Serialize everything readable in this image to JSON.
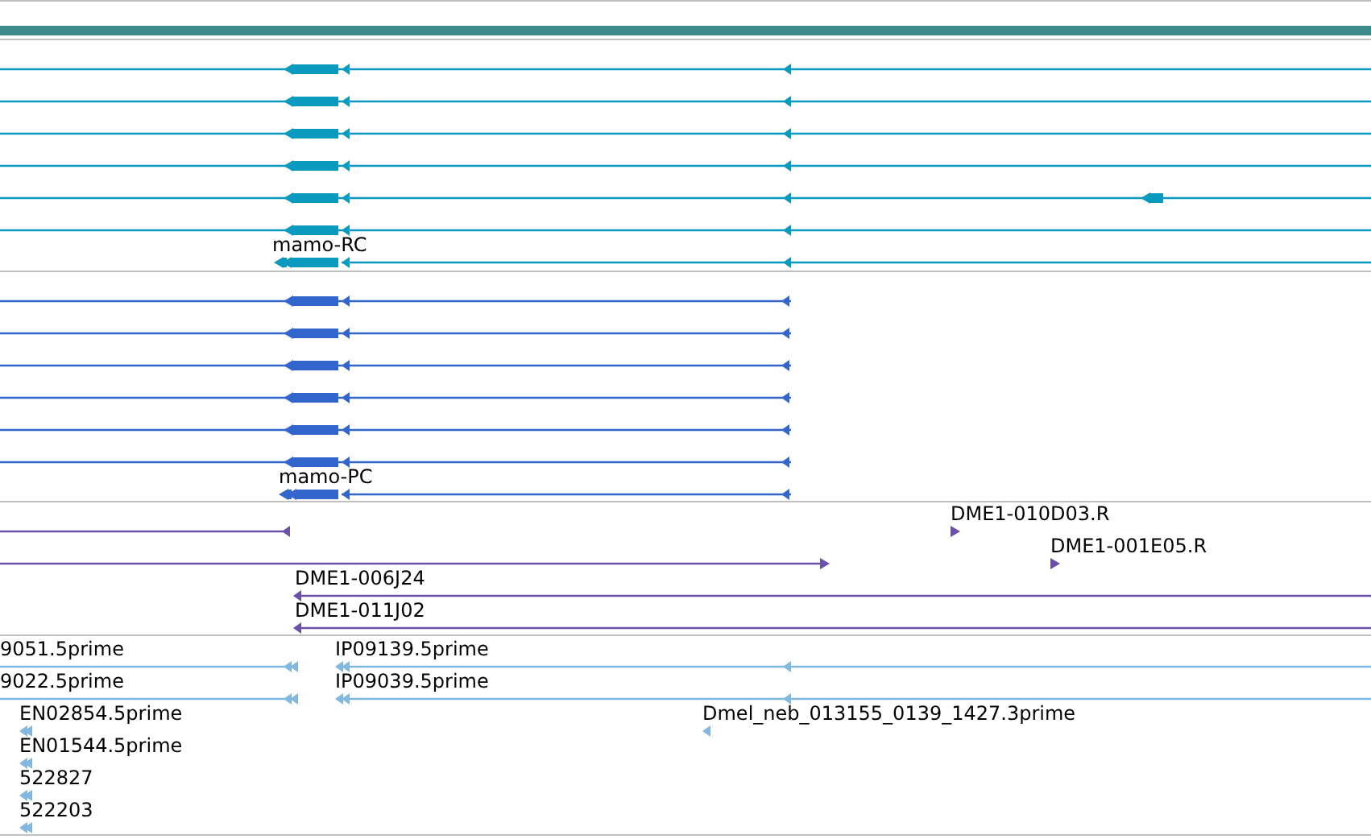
{
  "gene_tracks": [
    {
      "color": "#0a99bf",
      "transcripts": [
        {
          "kind": "plain"
        },
        {
          "kind": "plain"
        },
        {
          "kind": "plain"
        },
        {
          "kind": "plain"
        },
        {
          "kind": "extra-exon"
        },
        {
          "kind": "plain"
        },
        {
          "kind": "labeled",
          "label": "mamo-RC"
        }
      ]
    },
    {
      "color": "#3366cc",
      "transcripts": [
        {
          "kind": "plain"
        },
        {
          "kind": "plain"
        },
        {
          "kind": "plain"
        },
        {
          "kind": "plain"
        },
        {
          "kind": "plain"
        },
        {
          "kind": "plain"
        },
        {
          "kind": "labeled",
          "label": "mamo-PC"
        }
      ]
    }
  ],
  "clone_track": {
    "color": "#6b4fa8",
    "labels": [
      "DME1-010D03.R",
      "DME1-001E05.R",
      "DME1-006J24",
      "DME1-011J02"
    ]
  },
  "est_track": {
    "color": "#80b8e0",
    "labels": [
      "9051.5prime",
      "IP09139.5prime",
      "9022.5prime",
      "IP09039.5prime",
      "EN02854.5prime",
      "Dmel_neb_013155_0139_1427.3prime",
      "EN01544.5prime",
      "522827",
      "522203"
    ]
  }
}
